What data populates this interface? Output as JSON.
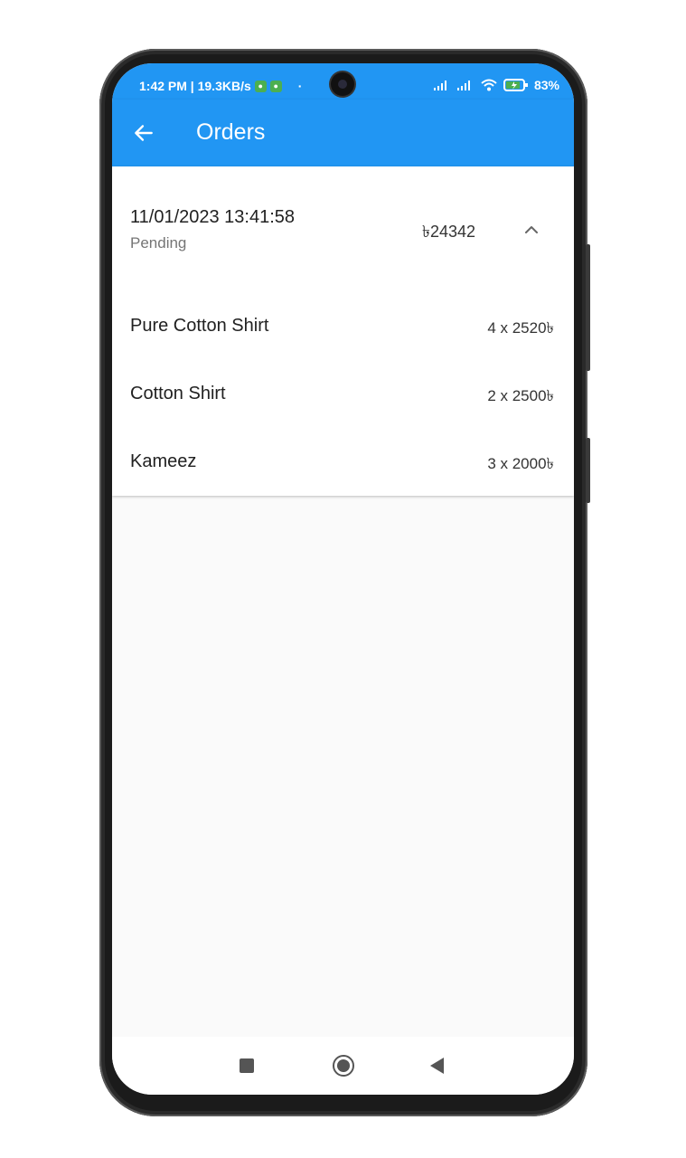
{
  "status_bar": {
    "time_speed": "1:42 PM | 19.3KB/s",
    "dot": "·",
    "battery": "83%"
  },
  "app_bar": {
    "title": "Orders"
  },
  "order": {
    "date": "11/01/2023 13:41:58",
    "status": "Pending",
    "total": "৳24342",
    "items": [
      {
        "name": "Pure Cotton Shirt",
        "qty": "4 x 2520৳"
      },
      {
        "name": "Cotton Shirt",
        "qty": "2 x 2500৳"
      },
      {
        "name": "Kameez",
        "qty": "3 x 2000৳"
      }
    ]
  },
  "colors": {
    "primary": "#2196F3",
    "background": "#fafafa"
  }
}
